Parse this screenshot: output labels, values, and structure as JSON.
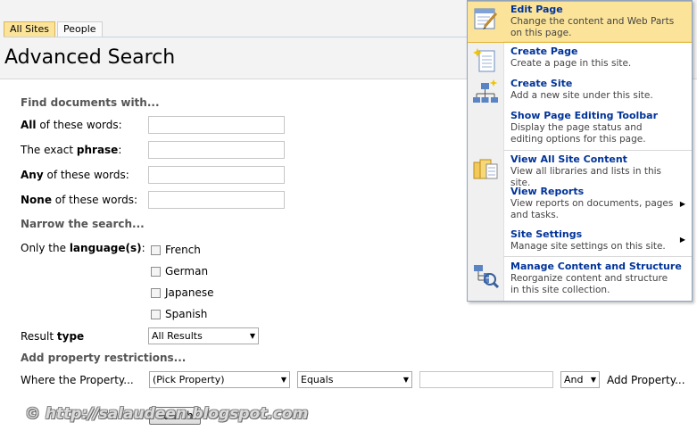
{
  "scope_tabs": [
    {
      "label": "All Sites",
      "active": true
    },
    {
      "label": "People",
      "active": false
    }
  ],
  "page_title": "Advanced Search",
  "find": {
    "heading": "Find documents with...",
    "rows": [
      {
        "bold": "All",
        "after": " of these words:",
        "value": ""
      },
      {
        "before": "The exact ",
        "bold": "phrase",
        "after": ":",
        "value": ""
      },
      {
        "bold": "Any",
        "after": " of these words:",
        "value": ""
      },
      {
        "bold": "None",
        "after": " of these words:",
        "value": ""
      }
    ]
  },
  "narrow": {
    "heading": "Narrow the search...",
    "language_label_before": "Only the ",
    "language_label_bold": "language(s)",
    "language_label_after": ":",
    "languages": [
      "French",
      "German",
      "Japanese",
      "Spanish"
    ],
    "result_type_before": "Result ",
    "result_type_bold": "type",
    "result_type_value": "All Results"
  },
  "property": {
    "heading": "Add property restrictions...",
    "where_label": "Where the Property...",
    "property_value": "(Pick Property)",
    "operator_value": "Equals",
    "value_text": "",
    "conjunction_value": "And",
    "add_property_label": "Add Property..."
  },
  "search_button_label": "Search",
  "watermark": "© http://salaudeen.blogspot.com",
  "menu": {
    "items": [
      {
        "title": "Edit Page",
        "desc": "Change the content and Web Parts on this page.",
        "icon": "edit-page-icon",
        "submenu": false,
        "highlighted": true
      },
      {
        "title": "Create Page",
        "desc": "Create a page in this site.",
        "icon": "create-page-icon",
        "submenu": false,
        "highlighted": false
      },
      {
        "title": "Create Site",
        "desc": "Add a new site under this site.",
        "icon": "create-site-icon",
        "submenu": false,
        "highlighted": false
      },
      {
        "title": "Show Page Editing Toolbar",
        "desc": "Display the page status and editing options for this page.",
        "icon": "none",
        "submenu": false,
        "highlighted": false
      },
      {
        "title": "View All Site Content",
        "desc": "View all libraries and lists in this site.",
        "icon": "site-content-icon",
        "submenu": false,
        "highlighted": false
      },
      {
        "title": "View Reports",
        "desc": "View reports on documents, pages and tasks.",
        "icon": "none",
        "submenu": true,
        "highlighted": false
      },
      {
        "title": "Site Settings",
        "desc": "Manage site settings on this site.",
        "icon": "none",
        "submenu": true,
        "highlighted": false
      },
      {
        "title": "Manage Content and Structure",
        "desc": "Reorganize content and structure in this site collection.",
        "icon": "manage-structure-icon",
        "submenu": false,
        "highlighted": false
      }
    ],
    "colors": {
      "highlight": "#fbe49a",
      "title": "#003399"
    }
  }
}
